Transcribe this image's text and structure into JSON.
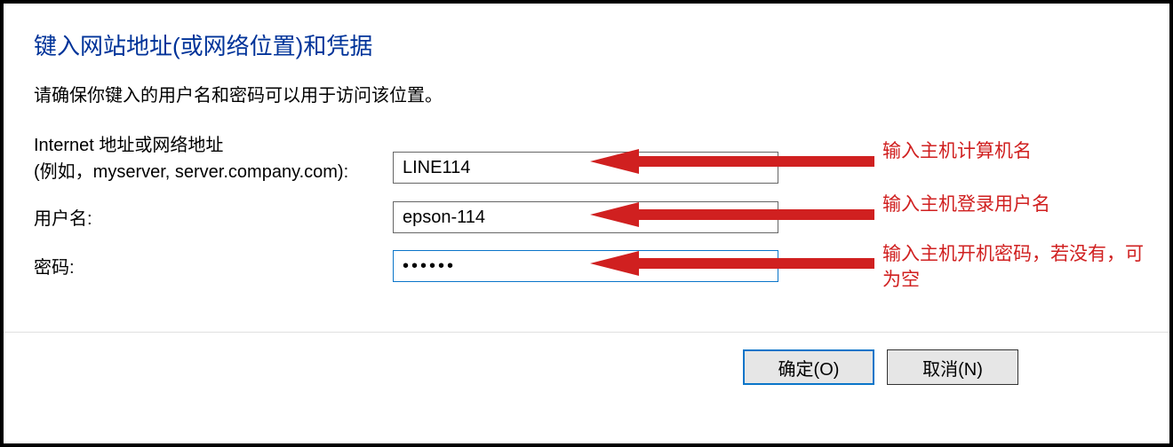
{
  "title": "键入网站地址(或网络位置)和凭据",
  "subtitle": "请确保你键入的用户名和密码可以用于访问该位置。",
  "labels": {
    "address_line1": "Internet 地址或网络地址",
    "address_line2": "(例如，myserver, server.company.com):",
    "username": "用户名:",
    "password": "密码:"
  },
  "inputs": {
    "address_value": "LINE114",
    "username_value": "epson-114",
    "password_value": "••••••"
  },
  "annotations": {
    "a1": "输入主机计算机名",
    "a2": "输入主机登录用户名",
    "a3": "输入主机开机密码，若没有，可为空"
  },
  "buttons": {
    "ok": "确定(O)",
    "cancel": "取消(N)"
  }
}
